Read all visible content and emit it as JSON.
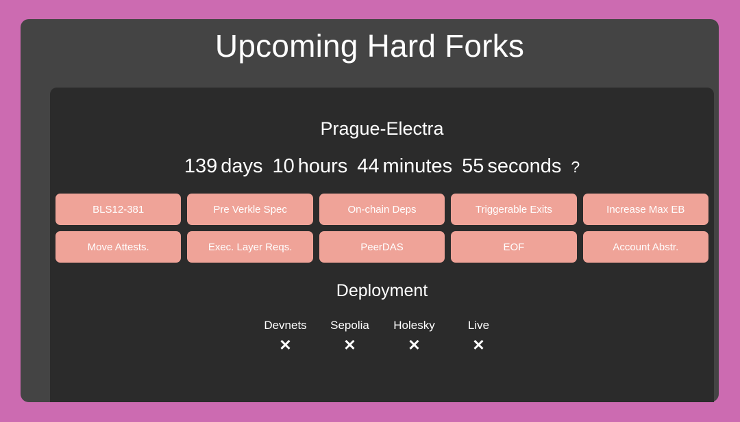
{
  "page": {
    "title": "Upcoming Hard Forks",
    "background_color": "#cc6bb1",
    "card_color": "#444444",
    "panel_color": "#2b2b2b",
    "chip_color": "#efa398",
    "text_color": "#ffffff"
  },
  "fork": {
    "name": "Prague-Electra",
    "countdown": {
      "days_value": "139",
      "days_unit": "days",
      "hours_value": "10",
      "hours_unit": "hours",
      "minutes_value": "44",
      "minutes_unit": "minutes",
      "seconds_value": "55",
      "seconds_unit": "seconds",
      "help": "?"
    },
    "features": [
      "BLS12-381",
      "Pre Verkle Spec",
      "On-chain Deps",
      "Triggerable Exits",
      "Increase Max EB",
      "Move Attests.",
      "Exec. Layer Reqs.",
      "PeerDAS",
      "EOF",
      "Account Abstr."
    ]
  },
  "deployment": {
    "title": "Deployment",
    "columns": [
      {
        "label": "Devnets",
        "status": "✕"
      },
      {
        "label": "Sepolia",
        "status": "✕"
      },
      {
        "label": "Holesky",
        "status": "✕"
      },
      {
        "label": "Live",
        "status": "✕"
      }
    ]
  }
}
